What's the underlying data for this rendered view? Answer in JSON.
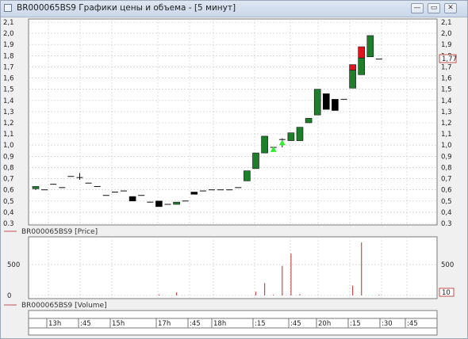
{
  "window": {
    "title": "BR000065BS9 Графики цены и объема - [5 минут]",
    "min_glyph": "—",
    "max_glyph": "▭",
    "close_glyph": "✕"
  },
  "colors": {
    "up": "#1e7f2a",
    "down": "#000000",
    "highlight": "#e0141e",
    "marker": "#33ee33",
    "volume": "#c0504d",
    "grid": "#c8c8c8",
    "label_box": "#c0504d"
  },
  "price_panel": {
    "legend_label": "BR000065BS9 [Price]",
    "y_ticks": [
      "2,1",
      "2,0",
      "1,9",
      "1,8",
      "1,7",
      "1,6",
      "1,5",
      "1,4",
      "1,3",
      "1,2",
      "1,1",
      "1,0",
      "0,9",
      "0,8",
      "0,7",
      "0,6",
      "0,5",
      "0,4",
      "0,3"
    ],
    "last_value_label": "1,77"
  },
  "volume_panel": {
    "legend_label": "BR000065BS9 [Volume]",
    "left_ticks": [
      "500",
      "0"
    ],
    "right_ticks": [
      "500"
    ],
    "last_value_label": "10"
  },
  "time_axis": [
    "13h",
    ":45",
    "15h",
    "17h",
    ":45",
    "18h",
    ":15",
    ":45",
    "20h",
    ":15",
    ":30",
    ":45"
  ],
  "chart_data": {
    "type": "candlestick",
    "series_name": "BR000065BS9",
    "ylim": [
      0.3,
      2.1
    ],
    "candles": [
      {
        "o": 0.61,
        "h": 0.63,
        "l": 0.6,
        "c": 0.63,
        "color": "up"
      },
      {
        "o": 0.6,
        "h": 0.6,
        "l": 0.6,
        "c": 0.6,
        "color": "flat"
      },
      {
        "o": 0.65,
        "h": 0.65,
        "l": 0.65,
        "c": 0.65,
        "color": "flat"
      },
      {
        "o": 0.62,
        "h": 0.62,
        "l": 0.62,
        "c": 0.62,
        "color": "flat"
      },
      {
        "o": 0.72,
        "h": 0.72,
        "l": 0.72,
        "c": 0.72,
        "color": "flat"
      },
      {
        "o": 0.71,
        "h": 0.75,
        "l": 0.69,
        "c": 0.71,
        "color": "flat"
      },
      {
        "o": 0.66,
        "h": 0.66,
        "l": 0.66,
        "c": 0.66,
        "color": "flat"
      },
      {
        "o": 0.63,
        "h": 0.63,
        "l": 0.63,
        "c": 0.63,
        "color": "flat"
      },
      {
        "o": 0.55,
        "h": 0.55,
        "l": 0.55,
        "c": 0.55,
        "color": "flat"
      },
      {
        "o": 0.58,
        "h": 0.58,
        "l": 0.58,
        "c": 0.58,
        "color": "flat"
      },
      {
        "o": 0.59,
        "h": 0.59,
        "l": 0.59,
        "c": 0.59,
        "color": "flat"
      },
      {
        "o": 0.54,
        "h": 0.54,
        "l": 0.5,
        "c": 0.5,
        "color": "down"
      },
      {
        "o": 0.55,
        "h": 0.55,
        "l": 0.55,
        "c": 0.55,
        "color": "flat"
      },
      {
        "o": 0.49,
        "h": 0.49,
        "l": 0.49,
        "c": 0.49,
        "color": "flat"
      },
      {
        "o": 0.5,
        "h": 0.5,
        "l": 0.45,
        "c": 0.45,
        "color": "down"
      },
      {
        "o": 0.47,
        "h": 0.47,
        "l": 0.47,
        "c": 0.47,
        "color": "flat"
      },
      {
        "o": 0.47,
        "h": 0.49,
        "l": 0.47,
        "c": 0.49,
        "color": "up"
      },
      {
        "o": 0.5,
        "h": 0.5,
        "l": 0.5,
        "c": 0.5,
        "color": "flat"
      },
      {
        "o": 0.58,
        "h": 0.58,
        "l": 0.56,
        "c": 0.56,
        "color": "down"
      },
      {
        "o": 0.59,
        "h": 0.59,
        "l": 0.59,
        "c": 0.59,
        "color": "flat"
      },
      {
        "o": 0.6,
        "h": 0.6,
        "l": 0.6,
        "c": 0.6,
        "color": "flat"
      },
      {
        "o": 0.6,
        "h": 0.6,
        "l": 0.6,
        "c": 0.6,
        "color": "flat"
      },
      {
        "o": 0.6,
        "h": 0.6,
        "l": 0.6,
        "c": 0.6,
        "color": "flat"
      },
      {
        "o": 0.62,
        "h": 0.62,
        "l": 0.62,
        "c": 0.62,
        "color": "flat"
      },
      {
        "o": 0.68,
        "h": 0.77,
        "l": 0.68,
        "c": 0.77,
        "color": "up"
      },
      {
        "o": 0.79,
        "h": 0.93,
        "l": 0.79,
        "c": 0.93,
        "color": "up"
      },
      {
        "o": 0.93,
        "h": 1.08,
        "l": 0.93,
        "c": 1.08,
        "color": "up"
      },
      {
        "o": 0.95,
        "h": 0.98,
        "l": 0.95,
        "c": 0.98,
        "color": "flat"
      },
      {
        "o": 1.05,
        "h": 1.06,
        "l": 0.98,
        "c": 1.05,
        "color": "flat"
      },
      {
        "o": 1.04,
        "h": 1.11,
        "l": 1.04,
        "c": 1.11,
        "color": "up"
      },
      {
        "o": 1.04,
        "h": 1.16,
        "l": 1.04,
        "c": 1.16,
        "color": "up"
      },
      {
        "o": 1.2,
        "h": 1.24,
        "l": 1.2,
        "c": 1.24,
        "color": "up"
      },
      {
        "o": 1.27,
        "h": 1.5,
        "l": 1.27,
        "c": 1.5,
        "color": "up"
      },
      {
        "o": 1.46,
        "h": 1.46,
        "l": 1.32,
        "c": 1.32,
        "color": "down"
      },
      {
        "o": 1.41,
        "h": 1.41,
        "l": 1.31,
        "c": 1.31,
        "color": "down"
      },
      {
        "o": 1.41,
        "h": 1.41,
        "l": 1.41,
        "c": 1.41,
        "color": "flat"
      },
      {
        "o": 1.51,
        "h": 1.72,
        "l": 1.51,
        "c": 1.67,
        "color": "up",
        "top_highlight_from": 1.67,
        "top_highlight_to": 1.72
      },
      {
        "o": 1.63,
        "h": 1.88,
        "l": 1.63,
        "c": 1.78,
        "color": "up",
        "top_highlight_from": 1.78,
        "top_highlight_to": 1.88
      },
      {
        "o": 1.79,
        "h": 1.98,
        "l": 1.79,
        "c": 1.98,
        "color": "up"
      },
      {
        "o": 1.77,
        "h": 1.77,
        "l": 1.77,
        "c": 1.77,
        "color": "flat"
      }
    ],
    "markers": [
      {
        "candle": 27,
        "price": 0.96
      },
      {
        "candle": 28,
        "price": 1.02
      }
    ],
    "volume_ylim": [
      0,
      900
    ],
    "volume": [
      0,
      0,
      0,
      0,
      0,
      0,
      0,
      0,
      0,
      0,
      0,
      0,
      0,
      0,
      15,
      0,
      50,
      0,
      0,
      0,
      0,
      0,
      0,
      0,
      0,
      60,
      200,
      10,
      480,
      680,
      20,
      0,
      0,
      0,
      0,
      0,
      160,
      860,
      0,
      10
    ]
  }
}
